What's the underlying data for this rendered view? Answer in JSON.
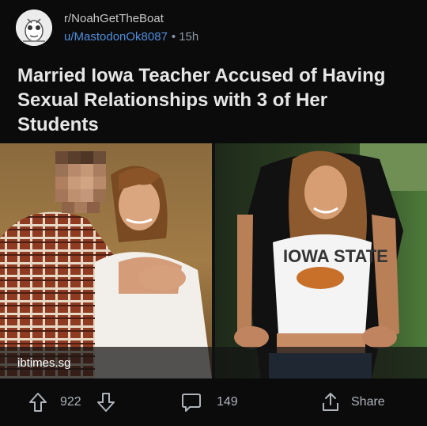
{
  "post": {
    "subreddit": "r/NoahGetTheBoat",
    "username": "u/MastodonOk8087",
    "separator": "•",
    "age": "15h",
    "title": "Married Iowa Teacher Accused of Having Sexual Relationships with 3 of Her Students",
    "link_domain": "ibtimes.sg",
    "shirt_text": "IOWA STATE"
  },
  "actions": {
    "upvotes": "922",
    "comments": "149",
    "share_label": "Share"
  },
  "colors": {
    "background": "#0b0b0c",
    "username_link": "#4f8edc",
    "action_text": "#aeb4b9"
  }
}
